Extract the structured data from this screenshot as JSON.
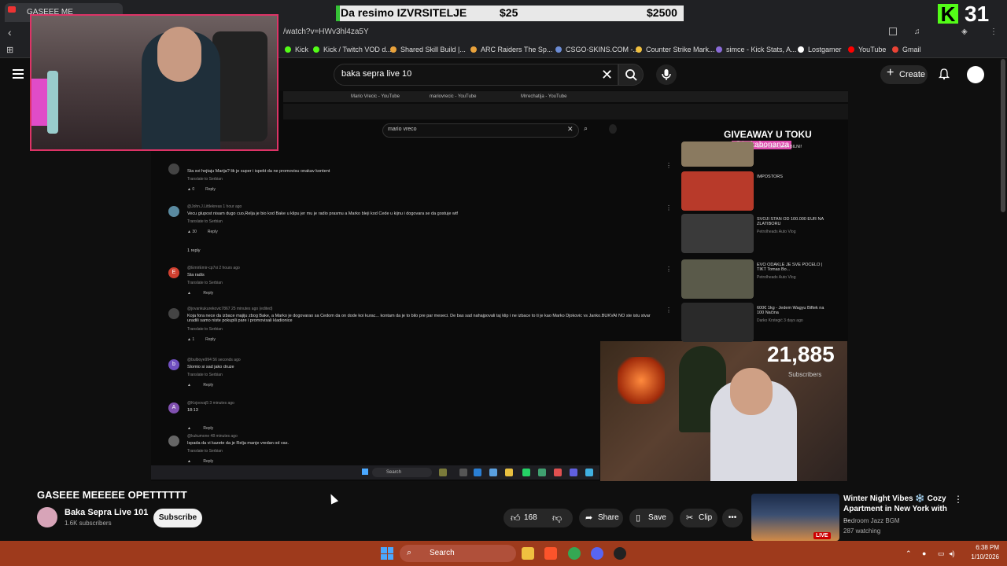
{
  "browser": {
    "tab_title": "GASEEE ME",
    "url": "/watch?v=HWv3hl4za5Y",
    "bookmarks": [
      {
        "label": "Kick",
        "color": "#53fc18"
      },
      {
        "label": "Kick / Twitch VOD d...",
        "color": "#53fc18"
      },
      {
        "label": "Shared Skill Build |...",
        "color": "#e9a23b"
      },
      {
        "label": "ARC Raiders The Sp...",
        "color": "#e9a23b"
      },
      {
        "label": "CSGO-SKINS.COM -...",
        "color": "#6c8cd5"
      },
      {
        "label": "Counter Strike Mark...",
        "color": "#f0c040"
      },
      {
        "label": "simce - Kick Stats, A...",
        "color": "#8a6bd8"
      },
      {
        "label": "Lostgamer",
        "color": "#ffffff"
      },
      {
        "label": "YouTube",
        "color": "#ff0000"
      },
      {
        "label": "Gmail",
        "color": "#ea4335"
      }
    ]
  },
  "overlay": {
    "banner_label": "Da resimo IZVRSITELJE",
    "banner_amount_1": "$25",
    "banner_amount_2": "$2500",
    "kick_letter": "K",
    "kick_number": "31"
  },
  "youtube": {
    "search_value": "baka sepra live 10",
    "create_label": "Create"
  },
  "inner_screen": {
    "tabs": [
      "Mario Vrecic - YouTube",
      "mariovrecic - YouTube",
      "Mrrechatija - YouTube"
    ],
    "search_value": "mario vreco",
    "comments": [
      {
        "avatar": "",
        "author": "",
        "text": "Sta svi hejtaju Marija? lik je super i ispekt da ne promovisu onakav kontent",
        "translate": "Translate to Serbian",
        "likes": "0"
      },
      {
        "avatar": "",
        "author": "@John.J.Littlekreas  1 hour ago",
        "text": "Vecu glupost nisam dugo cuo,Relja je bio kod Bake u klipu jer mu je radio prasmu a Marko bleji kod Cede u kijnu i dogovara se da gostuje wtf",
        "translate": "Translate to Serbian",
        "likes": "30"
      },
      {
        "avatar": "E",
        "author": "@EmirEmir-cp7xi  2 hours ago",
        "text": "Sta radis",
        "translate": "Translate to Serbian",
        "likes": ""
      },
      {
        "avatar": "",
        "author": "@jovankukurekovic7867  25 minutes ago (edited)",
        "text": "Koja fora nece da izbace majiju zbog Bake, a Marko je dogovarao sa Cedom da on dode koi kurac... kontam da je to bilo pre par meseci. De bas sad nahajpovali taj klip i ne izbace to ti je kao Marko Djokovic vs Janko.BUKVAI NO ste istu stvar uradili samo niste pokupili pare i promovisali kladionice",
        "translate": "Translate to Serbian",
        "likes": "1"
      },
      {
        "avatar": "b",
        "author": "@bulboye994  56 seconds ago",
        "text": "Slomio si sad jako druze",
        "translate": "Translate to Serbian",
        "likes": ""
      },
      {
        "avatar": "A",
        "author": "@Kojoovaj5  3 minutes ago",
        "text": "18:13",
        "translate": "",
        "likes": ""
      },
      {
        "avatar": "",
        "author": "@kukumone  48 minutes ago",
        "text": "Ispada da vi kazete da je Relja manje vredan od vas.",
        "translate": "Translate to Serbian",
        "likes": ""
      }
    ],
    "reply_toggle": "1 reply",
    "reply_label": "Reply",
    "side_videos": [
      {
        "title": "MALI BIBI LUKA BILNI!",
        "meta": "",
        "color": "#8a7a60"
      },
      {
        "title": "IMPOSTORS",
        "meta": "",
        "color": "#b83a2a"
      },
      {
        "title": "SVOJI STAN OD 100.000 EUR NA ZLATIBORU",
        "meta": "Petrolheads Auto Vlog",
        "color": "#3a3a3a"
      },
      {
        "title": "EVO ODAKLE JE SVE POCELO | TIKT Tomas Bo...",
        "meta": "Petrolheads Auto Vlog",
        "color": "#5a5a4a"
      },
      {
        "title": "600€ 1kg - Jedem Wagyu Biftek na 100 Načina",
        "meta": "Darko Krstegić  3 days ago",
        "color": "#2a2a2a"
      }
    ],
    "giveaway_text": "GIVEAWAY U TOKU",
    "giveaway_handle": "@bakabonanza",
    "subscriber_count": "21,885",
    "subscriber_label": "Subscribers",
    "taskbar_search": "Search"
  },
  "video": {
    "title": "GASEEE MEEEEE OPETTTTTT",
    "channel_name": "Baka Sepra Live 101",
    "channel_subs": "1.6K subscribers",
    "subscribe_label": "Subscribe",
    "like_count": "168",
    "share_label": "Share",
    "save_label": "Save",
    "clip_label": "Clip",
    "more_label": "•••"
  },
  "recommended": {
    "title": "Winter Night Vibes ❄️ Cozy Apartment in New York with ...",
    "channel": "Bedroom Jazz BGM",
    "watching": "287 watching",
    "live_badge": "LIVE"
  },
  "taskbar": {
    "search_label": "Search",
    "time": "6:38 PM",
    "date": "1/10/2026"
  }
}
